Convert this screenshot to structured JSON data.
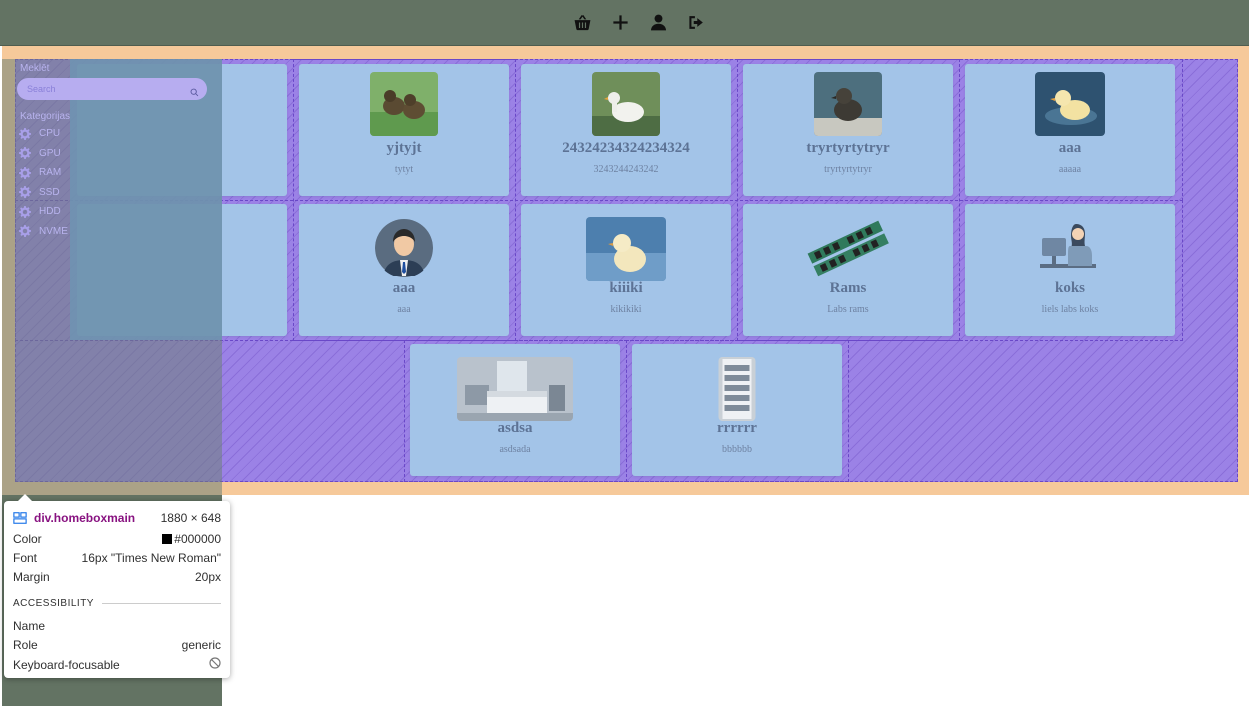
{
  "nav": {
    "icons": [
      "basket-icon",
      "plus-icon",
      "user-icon",
      "logout-icon"
    ]
  },
  "sidebar": {
    "title": "Meklēt",
    "search_placeholder": "Search",
    "categories_title": "Kategorijas",
    "categories": [
      "CPU",
      "GPU",
      "RAM",
      "SSD",
      "HDD",
      "NVME"
    ]
  },
  "products": [
    {
      "name": "yjtyjt",
      "desc": "tytyt",
      "image": "ducklings-grass"
    },
    {
      "name": "24324234324234324",
      "desc": "3243244243242",
      "image": "white-duck"
    },
    {
      "name": "tryrtyrtytryr",
      "desc": "tryrtyrtytryr",
      "image": "duckling-dark"
    },
    {
      "name": "aaa",
      "desc": "aaaaa",
      "image": "duckling-water"
    },
    {
      "name": "aaa",
      "desc": "aaa",
      "image": "businessman-avatar"
    },
    {
      "name": "kiiiki",
      "desc": "kikikiki",
      "image": "duckling-blue"
    },
    {
      "name": "Rams",
      "desc": "Labs rams",
      "image": "ram-sticks"
    },
    {
      "name": "koks",
      "desc": "liels labs koks",
      "image": "woman-at-computer"
    },
    {
      "name": "asdsa",
      "desc": "asdsada",
      "image": "bedroom"
    },
    {
      "name": "rrrrrr",
      "desc": "bbbbbb",
      "image": "shelf"
    }
  ],
  "devtools": {
    "element": "div.homeboxmain",
    "dims": "1880 × 648",
    "color_label": "Color",
    "color_value": "#000000",
    "font_label": "Font",
    "font_value": "16px \"Times New Roman\"",
    "margin_label": "Margin",
    "margin_value": "20px",
    "section": "ACCESSIBILITY",
    "name_label": "Name",
    "name_value": "",
    "role_label": "Role",
    "role_value": "generic",
    "focus_label": "Keyboard-focusable"
  }
}
